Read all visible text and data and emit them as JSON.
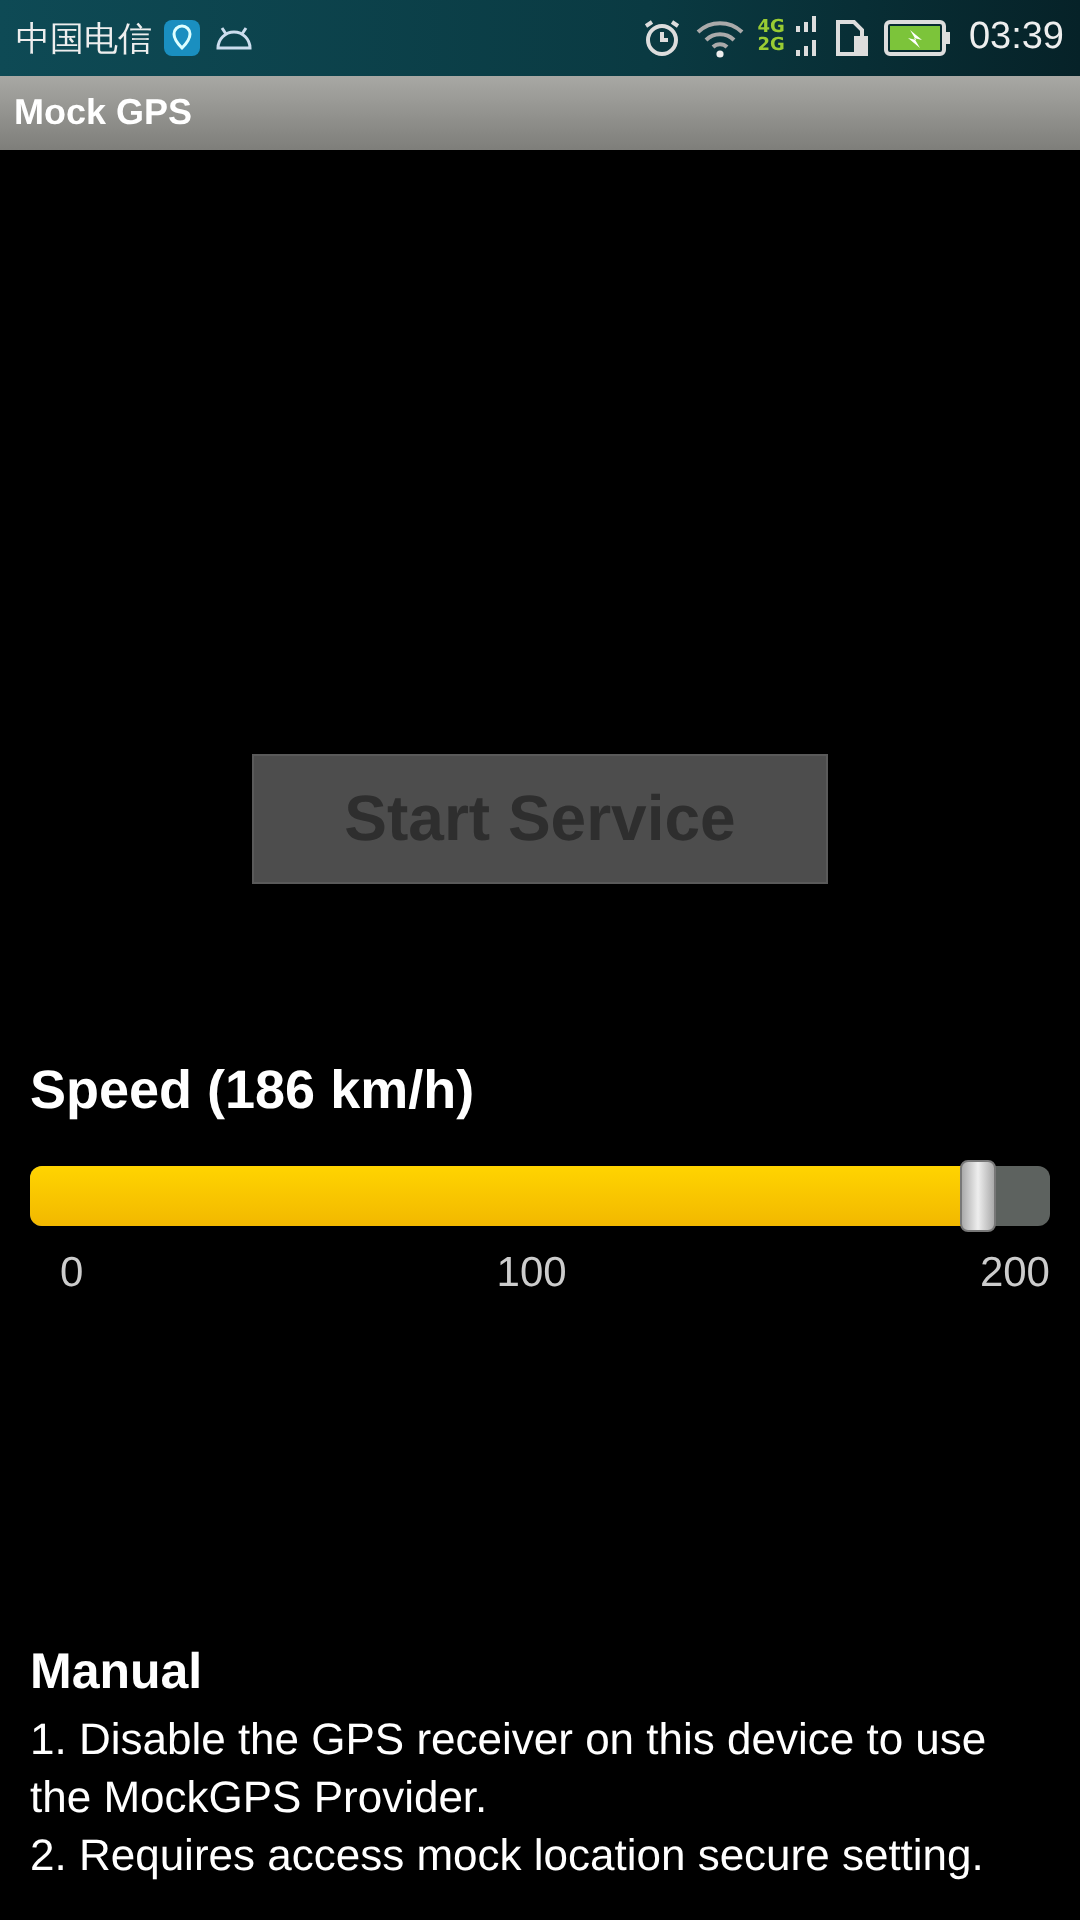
{
  "status_bar": {
    "carrier": "中国电信",
    "network": "4G",
    "network_2": "2G",
    "time": "03:39"
  },
  "title_bar": {
    "title": "Mock GPS"
  },
  "start_button": {
    "label": "Start Service",
    "disabled": true
  },
  "speed": {
    "label": "Speed (186 km/h)",
    "level": 0.93,
    "ticks": [
      "0",
      "100",
      "200"
    ]
  },
  "manual": {
    "heading": "Manual",
    "lines": [
      "1. Disable the GPS receiver on this device to use the MockGPS Provider.",
      "2. Requires access mock location secure setting."
    ]
  }
}
